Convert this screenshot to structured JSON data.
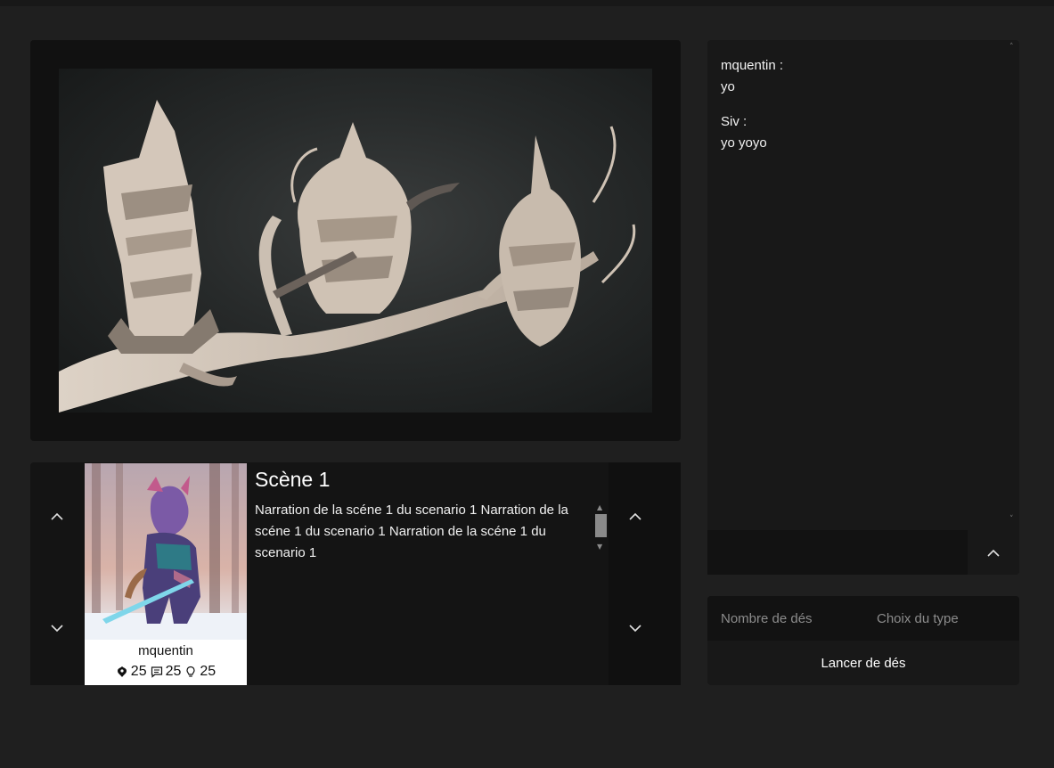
{
  "scene": {
    "image_alt": "Scene illustration",
    "title": "Scène 1",
    "narration": "Narration de la scéne 1 du scenario 1 Narration de la scéne 1 du scenario 1 Narration de la scéne 1 du scenario 1"
  },
  "character": {
    "name": "mquentin",
    "stats": [
      {
        "icon": "emblem-icon",
        "value": "25"
      },
      {
        "icon": "chat-bubble-icon",
        "value": "25"
      },
      {
        "icon": "lightbulb-icon",
        "value": "25"
      }
    ]
  },
  "chat": {
    "messages": [
      {
        "author": "mquentin :",
        "text": "yo"
      },
      {
        "author": "Siv :",
        "text": "yo yoyo"
      }
    ],
    "input_placeholder": ""
  },
  "dice": {
    "count_placeholder": "Nombre de dés",
    "type_placeholder": "Choix du type",
    "roll_label": "Lancer de dés"
  },
  "colors": {
    "background": "#1f1f1f",
    "panel": "#111111",
    "text": "#e8e8e8"
  }
}
